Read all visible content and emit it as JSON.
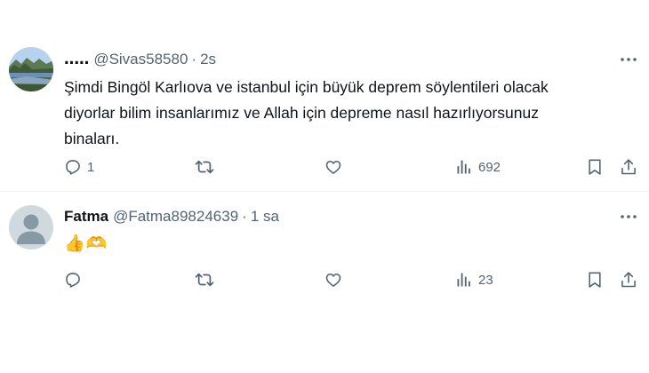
{
  "tweets": [
    {
      "display_name": "․․․․․",
      "handle": "@Sivas58580",
      "separator": "·",
      "time": "2s",
      "text_lines": [
        "Şimdi Bingöl Karlıova ve istanbul için büyük deprem söylentileri olacak",
        "diyorlar bilim insanlarımız ve Allah için depreme nasıl hazırlıyorsunuz",
        "binaları."
      ],
      "replies": "1",
      "reposts": "",
      "likes": "",
      "views": "692",
      "avatar": "landscape-photo"
    },
    {
      "display_name": "Fatma",
      "handle": "@Fatma89824639",
      "separator": "·",
      "time": "1 sa",
      "emojis": [
        "👍",
        "🫶"
      ],
      "replies": "",
      "reposts": "",
      "likes": "",
      "views": "23",
      "avatar": "default-profile-silhouette"
    }
  ],
  "icons": {
    "reply": "reply-icon",
    "repost": "repost-icon",
    "like": "like-icon",
    "views": "views-icon",
    "bookmark": "bookmark-icon",
    "share": "share-icon",
    "more": "more-icon"
  },
  "colors": {
    "text_primary": "#0f1419",
    "text_secondary": "#536471",
    "divider": "#eff3f4",
    "default_avatar_bg": "#cfd9de"
  }
}
